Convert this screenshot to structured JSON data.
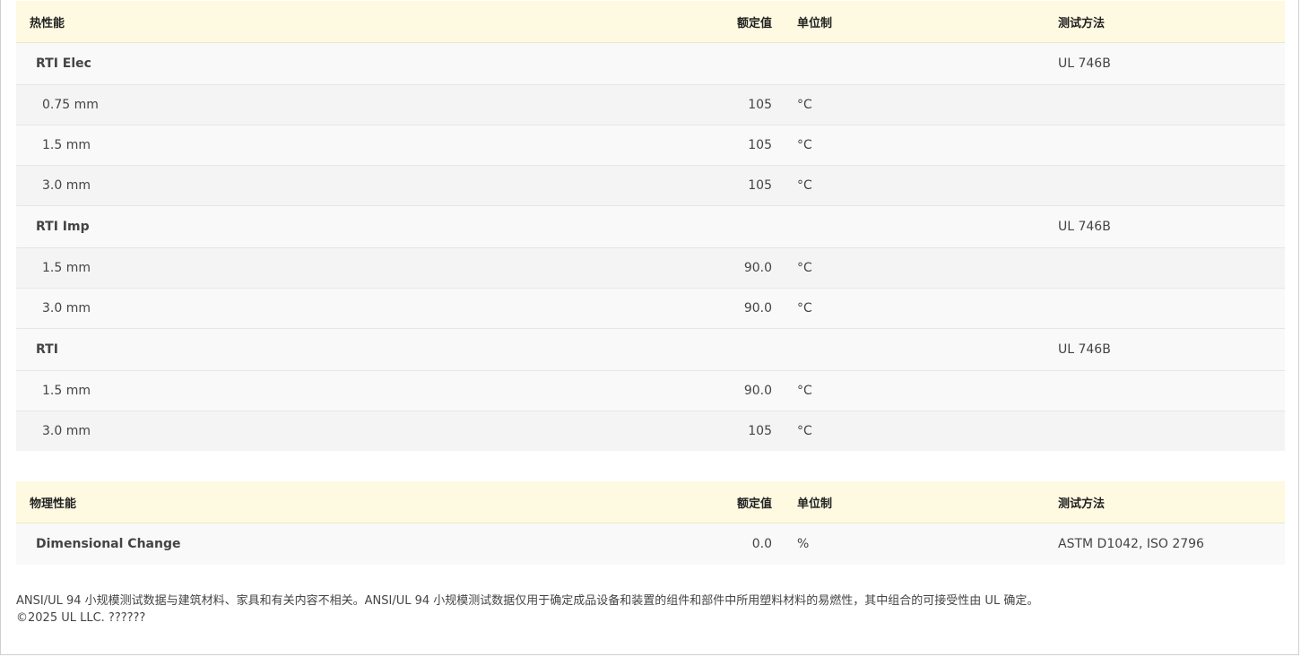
{
  "thermal_table": {
    "headers": {
      "name": "热性能",
      "value": "额定值",
      "unit": "单位制",
      "test": "测试方法"
    },
    "groups": [
      {
        "name": "RTI Elec",
        "test": "UL 746B",
        "rows": [
          {
            "thickness": "0.75 mm",
            "value": "105",
            "unit": "°C"
          },
          {
            "thickness": "1.5 mm",
            "value": "105",
            "unit": "°C"
          },
          {
            "thickness": "3.0 mm",
            "value": "105",
            "unit": "°C"
          }
        ]
      },
      {
        "name": "RTI Imp",
        "test": "UL 746B",
        "rows": [
          {
            "thickness": "1.5 mm",
            "value": "90.0",
            "unit": "°C"
          },
          {
            "thickness": "3.0 mm",
            "value": "90.0",
            "unit": "°C"
          }
        ]
      },
      {
        "name": "RTI",
        "test": "UL 746B",
        "rows": [
          {
            "thickness": "1.5 mm",
            "value": "90.0",
            "unit": "°C"
          },
          {
            "thickness": "3.0 mm",
            "value": "105",
            "unit": "°C"
          }
        ]
      }
    ]
  },
  "physical_table": {
    "headers": {
      "name": "物理性能",
      "value": "额定值",
      "unit": "单位制",
      "test": "测试方法"
    },
    "rows": [
      {
        "name": "Dimensional Change",
        "value": "0.0",
        "unit": "%",
        "test": "ASTM D1042, ISO 2796"
      }
    ]
  },
  "footer": {
    "disclaimer": "ANSI/UL 94 小规模测试数据与建筑材料、家具和有关内容不相关。ANSI/UL 94 小规模测试数据仅用于确定成品设备和装置的组件和部件中所用塑料材料的易燃性，其中组合的可接受性由 UL 确定。",
    "copyright": "©2025 UL LLC. ??????"
  }
}
